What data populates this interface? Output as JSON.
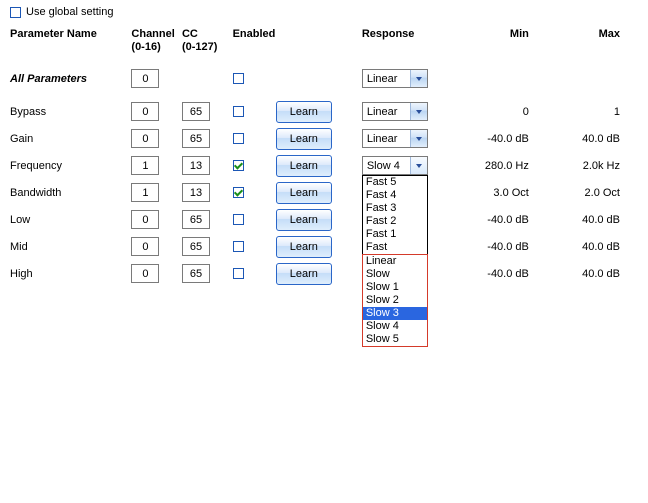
{
  "global": {
    "label": "Use global setting",
    "checked": false
  },
  "headers": {
    "name": "Parameter Name",
    "channel": "Channel",
    "channel_sub": "(0-16)",
    "cc": "CC",
    "cc_sub": "(0-127)",
    "enabled": "Enabled",
    "learn": "",
    "response": "Response",
    "min": "Min",
    "max": "Max"
  },
  "allRow": {
    "name": "All Parameters",
    "channel": "0",
    "response": "Linear"
  },
  "learnLabel": "Learn",
  "rows": [
    {
      "name": "Bypass",
      "channel": "0",
      "cc": "65",
      "enabled": false,
      "response": "Linear",
      "min": "0",
      "max": "1"
    },
    {
      "name": "Gain",
      "channel": "0",
      "cc": "65",
      "enabled": false,
      "response": "Linear",
      "min": "-40.0 dB",
      "max": "40.0 dB"
    },
    {
      "name": "Frequency",
      "channel": "1",
      "cc": "13",
      "enabled": true,
      "response": "Slow 4",
      "min": "280.0 Hz",
      "max": "2.0k Hz",
      "dropdownOpen": true
    },
    {
      "name": "Bandwidth",
      "channel": "1",
      "cc": "13",
      "enabled": true,
      "response": "",
      "min": "3.0 Oct",
      "max": "2.0 Oct"
    },
    {
      "name": "Low",
      "channel": "0",
      "cc": "65",
      "enabled": false,
      "response": "",
      "min": "-40.0 dB",
      "max": "40.0 dB"
    },
    {
      "name": "Mid",
      "channel": "0",
      "cc": "65",
      "enabled": false,
      "response": "",
      "min": "-40.0 dB",
      "max": "40.0 dB"
    },
    {
      "name": "High",
      "channel": "0",
      "cc": "65",
      "enabled": false,
      "response": "",
      "min": "-40.0 dB",
      "max": "40.0 dB"
    }
  ],
  "dropdown": {
    "top": [
      "Fast 5",
      "Fast 4",
      "Fast 3",
      "Fast 2",
      "Fast 1",
      "Fast"
    ],
    "bottom": [
      "Linear",
      "Slow",
      "Slow 1",
      "Slow 2",
      "Slow 3",
      "Slow 4",
      "Slow 5"
    ],
    "selected": "Slow 3"
  }
}
